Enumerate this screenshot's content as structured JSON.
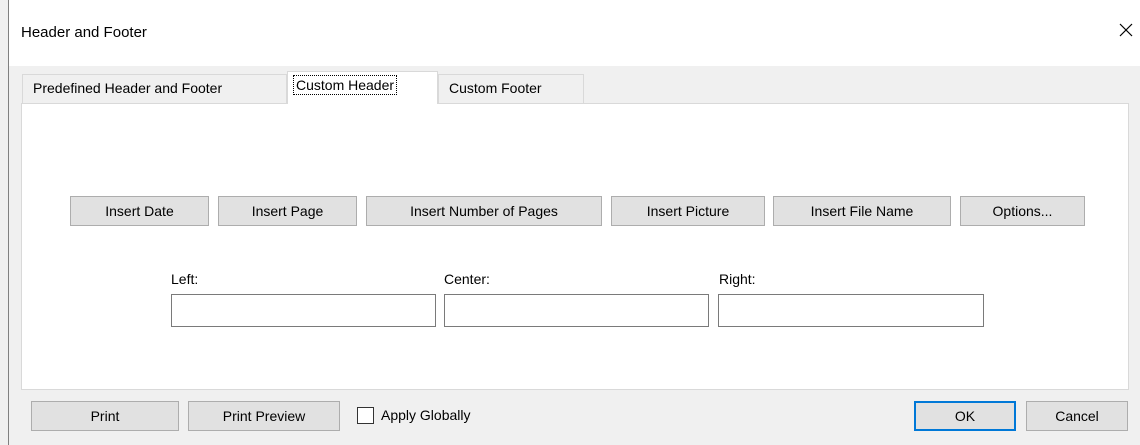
{
  "window": {
    "title": "Header and Footer",
    "close_symbol": "✕"
  },
  "tabs": [
    {
      "label": "Predefined Header and Footer",
      "active": false
    },
    {
      "label": "Custom Header",
      "active": true
    },
    {
      "label": "Custom Footer",
      "active": false
    }
  ],
  "insert_buttons": [
    {
      "label": "Insert Date"
    },
    {
      "label": "Insert Page"
    },
    {
      "label": "Insert Number of Pages"
    },
    {
      "label": "Insert Picture"
    },
    {
      "label": "Insert File Name"
    },
    {
      "label": "Options..."
    }
  ],
  "fields": {
    "left": {
      "label": "Left:",
      "value": ""
    },
    "center": {
      "label": "Center:",
      "value": ""
    },
    "right": {
      "label": "Right:",
      "value": ""
    }
  },
  "footer": {
    "print_label": "Print",
    "print_preview_label": "Print Preview",
    "apply_globally_label": "Apply Globally",
    "apply_globally_checked": false,
    "ok_label": "OK",
    "cancel_label": "Cancel"
  }
}
